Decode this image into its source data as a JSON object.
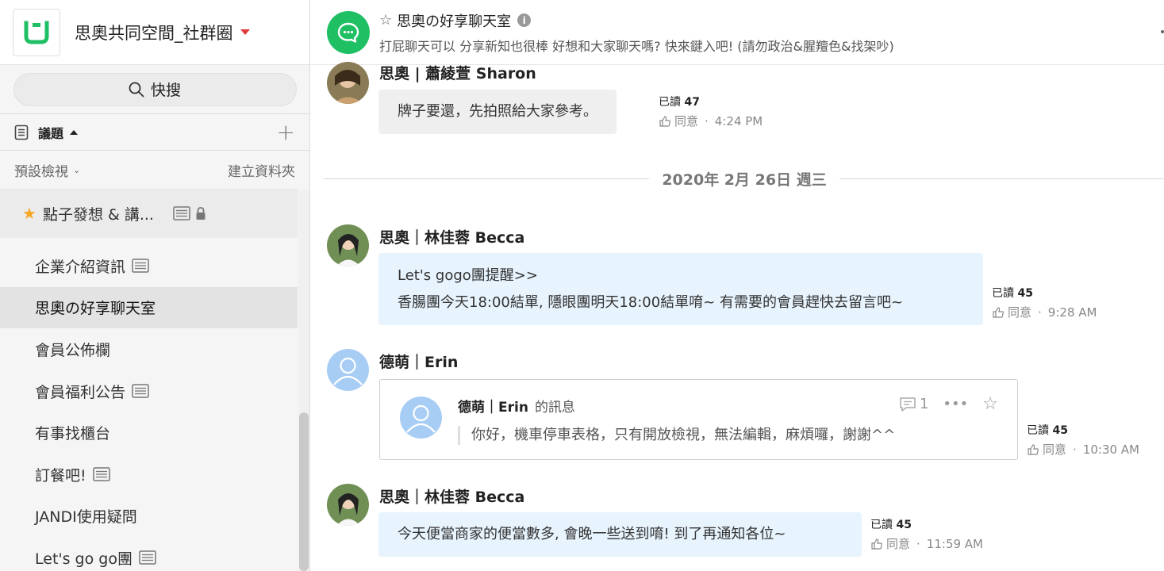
{
  "workspace": {
    "name": "思奧共同空間_社群圈"
  },
  "search": {
    "label": "快搜"
  },
  "topics": {
    "header": "議題",
    "view_label": "預設檢視",
    "new_folder": "建立資料夾"
  },
  "favorite": {
    "label": "點子發想 & 講..."
  },
  "sidebar": {
    "items": [
      {
        "label": "企業介紹資訊",
        "doc": true,
        "active": false
      },
      {
        "label": "思奧の好享聊天室",
        "doc": false,
        "active": true
      },
      {
        "label": "會員公佈欄",
        "doc": false,
        "active": false
      },
      {
        "label": "會員福利公告",
        "doc": true,
        "active": false
      },
      {
        "label": "有事找櫃台",
        "doc": false,
        "active": false
      },
      {
        "label": "訂餐吧!",
        "doc": true,
        "active": false
      },
      {
        "label": "JANDI使用疑問",
        "doc": false,
        "active": false
      },
      {
        "label": "Let's go go團",
        "doc": true,
        "active": false
      }
    ]
  },
  "room": {
    "title": "思奧の好享聊天室",
    "description": "打屁聊天可以 分享新知也很棒 好想和大家聊天嗎? 快來鍵入吧! (請勿政治&腥羶色&找架吵)"
  },
  "date_separator": "2020年 2月 26日 週三",
  "messages": [
    {
      "sender": "思奧 | 蕭綾萱 Sharon",
      "lines": [
        "牌子要還，先拍照給大家參考。"
      ],
      "read_label": "已讀",
      "read_count": "47",
      "agree": "同意",
      "time": "4:24 PM"
    },
    {
      "sender": "思奧｜林佳蓉 Becca",
      "lines": [
        "Let's gogo團提醒>>",
        "香腸團今天18:00結單, 隱眼團明天18:00結單唷~ 有需要的會員趕快去留言吧~"
      ],
      "read_label": "已讀",
      "read_count": "45",
      "agree": "同意",
      "time": "9:28 AM"
    },
    {
      "sender": "德萌｜Erin",
      "read_label": "已讀",
      "read_count": "45",
      "agree": "同意",
      "time": "10:30 AM",
      "card": {
        "sender": "德萌｜Erin",
        "suffix": "的訊息",
        "comment_count": "1",
        "body": "你好，機車停車表格，只有開放檢視，無法編輯，麻煩囉，謝謝^^"
      }
    },
    {
      "sender": "思奧｜林佳蓉 Becca",
      "lines": [
        "今天便當商家的便當數多, 會晚一些送到唷! 到了再通知各位~"
      ],
      "read_label": "已讀",
      "read_count": "45",
      "agree": "同意",
      "time": "11:59 AM"
    }
  ],
  "colors": {
    "brand_green": "#1fbf64",
    "bubble_blue": "#e7f3fd",
    "bubble_gray": "#efefef",
    "caret_red": "#e03a3a",
    "star_yellow": "#f5a623"
  }
}
